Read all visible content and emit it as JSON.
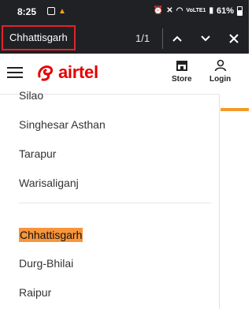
{
  "status_bar": {
    "time": "8:25",
    "battery_percent": "61%",
    "network_label": "VoLTE1"
  },
  "find_bar": {
    "query": "Chhattisgarh",
    "match_count": "1/1"
  },
  "header": {
    "brand": "airtel",
    "store_label": "Store",
    "login_label": "Login"
  },
  "list_group_1": [
    "Silao",
    "Singhesar Asthan",
    "Tarapur",
    "Warisaliganj"
  ],
  "list_group_2": {
    "heading": "Chhattisgarh",
    "items": [
      "Durg-Bhilai",
      "Raipur"
    ]
  },
  "colors": {
    "brand_red": "#e40000",
    "highlight_orange": "#f7953b",
    "find_border_red": "#e0232a"
  }
}
